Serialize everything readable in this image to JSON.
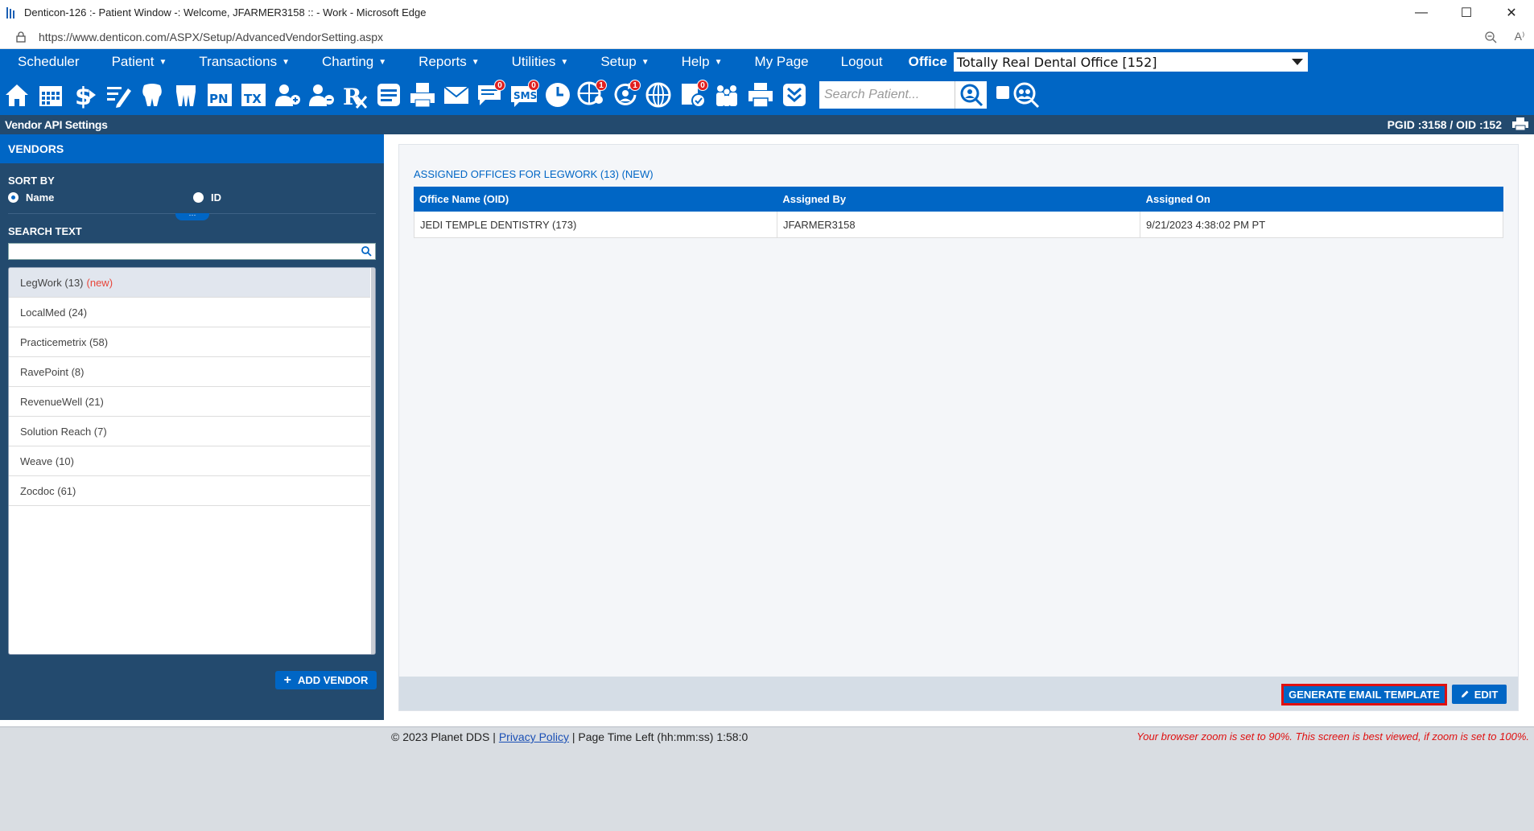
{
  "browser": {
    "title": "Denticon-126 :- Patient Window -: Welcome, JFARMER3158 :: - Work - Microsoft Edge",
    "url": "https://www.denticon.com/ASPX/Setup/AdvancedVendorSetting.aspx"
  },
  "nav": {
    "items": [
      {
        "label": "Scheduler",
        "caret": false
      },
      {
        "label": "Patient",
        "caret": true
      },
      {
        "label": "Transactions",
        "caret": true
      },
      {
        "label": "Charting",
        "caret": true
      },
      {
        "label": "Reports",
        "caret": true
      },
      {
        "label": "Utilities",
        "caret": true
      },
      {
        "label": "Setup",
        "caret": true
      },
      {
        "label": "Help",
        "caret": true
      },
      {
        "label": "My Page",
        "caret": false
      },
      {
        "label": "Logout",
        "caret": false
      }
    ],
    "office_label": "Office",
    "office_value": "Totally Real Dental Office [152]"
  },
  "toolbar": {
    "icons": [
      "home-icon",
      "calendar-icon",
      "dollar-icon",
      "edit-list-icon",
      "tooth-icon",
      "teeth-icon",
      "pn-icon",
      "tx-icon",
      "add-patient-icon",
      "patients-icon",
      "rx-icon",
      "notes-icon",
      "printer-doc-icon",
      "email-icon",
      "messages-icon",
      "sms-icon",
      "clock-icon",
      "globe-user-icon",
      "refresh-user-icon",
      "globe-icon",
      "doc-check-icon",
      "family-icon",
      "printer-icon",
      "download-icon"
    ],
    "badges": {
      "messages": "0",
      "sms": "0",
      "globe_user": "1",
      "refresh_user": "1",
      "doc_check": "0"
    },
    "search_placeholder": "Search Patient..."
  },
  "subheader": {
    "page_name": "Vendor API Settings",
    "ids": "PGID :3158  /  OID :152"
  },
  "sidebar": {
    "heading": "VENDORS",
    "sort_by": "SORT BY",
    "sort_name": "Name",
    "sort_id": "ID",
    "search_label": "SEARCH TEXT",
    "vendors": [
      {
        "name": "LegWork (13)",
        "tag": "(new)"
      },
      {
        "name": "LocalMed (24)",
        "tag": ""
      },
      {
        "name": "Practicemetrix (58)",
        "tag": ""
      },
      {
        "name": "RavePoint (8)",
        "tag": ""
      },
      {
        "name": "RevenueWell (21)",
        "tag": ""
      },
      {
        "name": "Solution Reach (7)",
        "tag": ""
      },
      {
        "name": "Weave (10)",
        "tag": ""
      },
      {
        "name": "Zocdoc (61)",
        "tag": ""
      }
    ],
    "add_vendor": "ADD VENDOR"
  },
  "main": {
    "title": "ASSIGNED OFFICES FOR LEGWORK (13) (NEW)",
    "columns": [
      "Office Name (OID)",
      "Assigned By",
      "Assigned On"
    ],
    "rows": [
      [
        "JEDI TEMPLE DENTISTRY (173)",
        "JFARMER3158",
        "9/21/2023 4:38:02 PM PT"
      ]
    ],
    "generate_label": "GENERATE EMAIL TEMPLATE",
    "edit_label": "EDIT"
  },
  "footer": {
    "copyright": "© 2023 Planet DDS",
    "privacy": "Privacy Policy",
    "time_left": "Page Time Left (hh:mm:ss) 1:58:0",
    "zoom_warning": "Your browser zoom is set to 90%. This screen is best viewed, if zoom is set to 100%."
  }
}
